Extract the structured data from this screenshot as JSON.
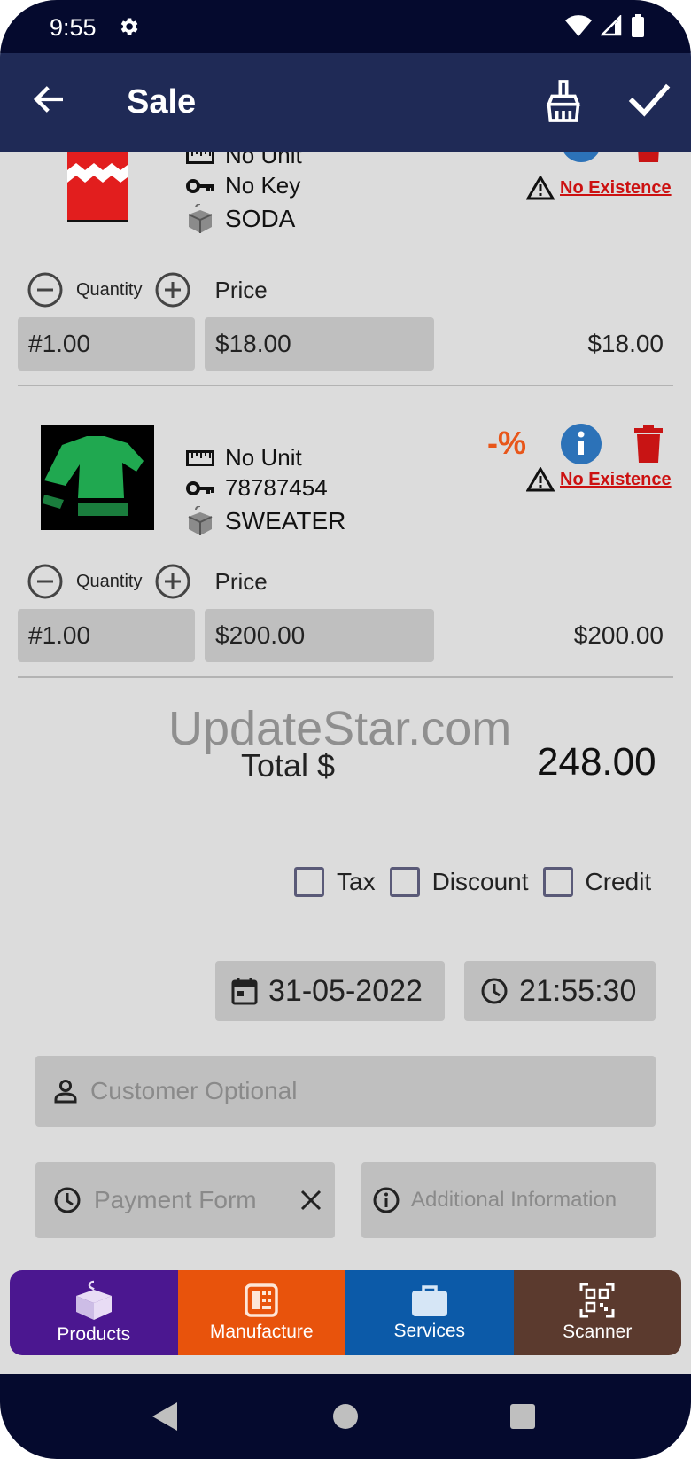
{
  "status_bar": {
    "time": "9:55"
  },
  "app_bar": {
    "title": "Sale"
  },
  "products": [
    {
      "unit": "No Unit",
      "key": "No Key",
      "name": "SODA",
      "discount_label": "-%",
      "warning": "No Existence",
      "quantity_label": "Quantity",
      "price_label": "Price",
      "quantity_value": "#1.00",
      "price_value": "$18.00",
      "line_total": "$18.00"
    },
    {
      "unit": "No Unit",
      "key": "78787454",
      "name": "SWEATER",
      "discount_label": "-%",
      "warning": "No Existence",
      "quantity_label": "Quantity",
      "price_label": "Price",
      "quantity_value": "#1.00",
      "price_value": "$200.00",
      "line_total": "$200.00"
    }
  ],
  "watermark": "UpdateStar.com",
  "total": {
    "label": "Total  $",
    "value": "248.00"
  },
  "options": {
    "tax": "Tax",
    "discount": "Discount",
    "credit": "Credit"
  },
  "date": "31-05-2022",
  "time": "21:55:30",
  "customer": {
    "placeholder": "Customer Optional"
  },
  "payment": {
    "placeholder": "Payment Form"
  },
  "additional": {
    "placeholder": "Additional Information"
  },
  "bottom_tabs": [
    {
      "label": "Products",
      "color": "#4b1790"
    },
    {
      "label": "Manufacture",
      "color": "#e8530c"
    },
    {
      "label": "Services",
      "color": "#0c5aa8"
    },
    {
      "label": "Scanner",
      "color": "#5b3a2e"
    }
  ],
  "colors": {
    "status_bar": "#050a2e",
    "app_bar": "#1f2a56",
    "background": "#dcdcdc",
    "discount": "#e8561a",
    "warning": "#cc1111",
    "info": "#2c72b8",
    "trash": "#c81414"
  }
}
